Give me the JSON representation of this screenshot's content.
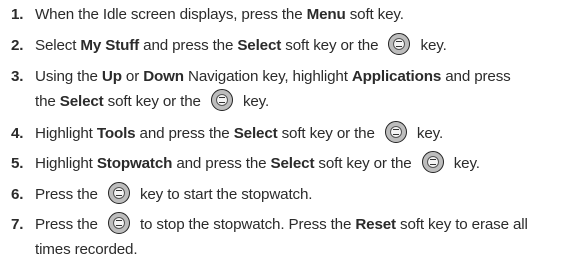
{
  "key_icon": "ok-select-key-icon",
  "steps": [
    {
      "number": "1.",
      "lines": [
        [
          "When the Idle screen displays, press the ",
          {
            "b": "Menu"
          },
          " soft key."
        ]
      ]
    },
    {
      "number": "2.",
      "lines": [
        [
          "Select ",
          {
            "b": "My Stuff"
          },
          " and press the ",
          {
            "b": "Select"
          },
          " soft key or the ",
          {
            "icon": true
          },
          " key."
        ]
      ]
    },
    {
      "number": "3.",
      "lines": [
        [
          "Using the ",
          {
            "b": "Up"
          },
          " or ",
          {
            "b": "Down"
          },
          " Navigation key, highlight ",
          {
            "b": "Applications"
          },
          " and press"
        ],
        [
          "the ",
          {
            "b": "Select"
          },
          " soft key or the ",
          {
            "icon": true
          },
          " key."
        ]
      ]
    },
    {
      "number": "4.",
      "lines": [
        [
          "Highlight ",
          {
            "b": "Tools"
          },
          " and press the ",
          {
            "b": "Select"
          },
          " soft key or the ",
          {
            "icon": true
          },
          " key."
        ]
      ]
    },
    {
      "number": "5.",
      "lines": [
        [
          "Highlight ",
          {
            "b": "Stopwatch"
          },
          " and press the ",
          {
            "b": "Select"
          },
          " soft key or the ",
          {
            "icon": true
          },
          " key."
        ]
      ]
    },
    {
      "number": "6.",
      "lines": [
        [
          "Press the ",
          {
            "icon": true
          },
          " key to start the stopwatch."
        ]
      ]
    },
    {
      "number": "7.",
      "lines": [
        [
          "Press the ",
          {
            "icon": true
          },
          " to stop the stopwatch. Press the ",
          {
            "b": "Reset"
          },
          " soft key to erase all"
        ],
        [
          "times recorded."
        ]
      ]
    }
  ]
}
